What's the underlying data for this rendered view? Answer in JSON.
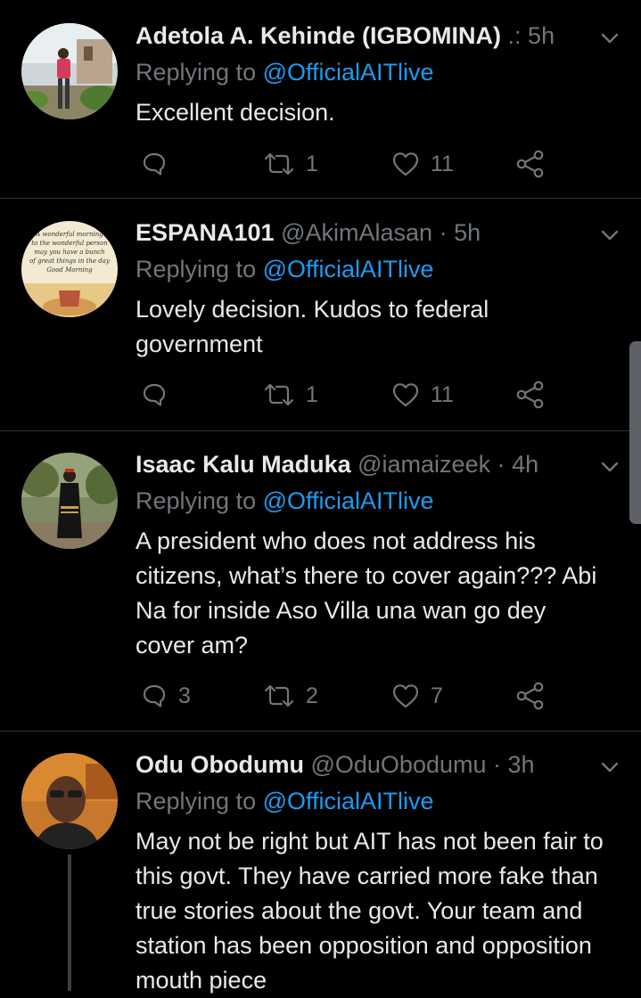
{
  "tweets": [
    {
      "name": "Adetola A. Kehinde (IGBOMINA)",
      "handle": "",
      "separator": ".:",
      "time": "5h",
      "replying_prefix": "Replying to",
      "replying_mention": "@OfficialAITlive",
      "text": "Excellent decision.",
      "replies": "",
      "retweets": "1",
      "likes": "11"
    },
    {
      "name": "ESPANA101",
      "handle": "@AkimAlasan",
      "separator": "·",
      "time": "5h",
      "replying_prefix": "Replying to",
      "replying_mention": "@OfficialAITlive",
      "text": "Lovely decision. Kudos to federal government",
      "replies": "",
      "retweets": "1",
      "likes": "11",
      "avatar_text": [
        "A wonderful morning",
        "to the wonderful person",
        "may you have a bunch",
        "of great things in the day",
        "Good Morning"
      ]
    },
    {
      "name": "Isaac Kalu Maduka",
      "handle": "@iamaizeek",
      "separator": "·",
      "time": "4h",
      "replying_prefix": "Replying to",
      "replying_mention": "@OfficialAITlive",
      "text": "A president who does not address his citizens, what’s there to cover again??? Abi Na for inside Aso Villa una wan go dey cover am?",
      "replies": "3",
      "retweets": "2",
      "likes": "7"
    },
    {
      "name": "Odu Obodumu",
      "handle": "@OduObodumu",
      "separator": "·",
      "time": "3h",
      "replying_prefix": "Replying to",
      "replying_mention": "@OfficialAITlive",
      "text": "May not be right but AIT has not been fair to this govt. They have carried more fake than true stories about the govt. Your team and station has been opposition and opposition mouth piece",
      "replies": "",
      "retweets": "",
      "likes": ""
    }
  ],
  "icons": {
    "reply": "reply-icon",
    "retweet": "retweet-icon",
    "like": "heart-icon",
    "share": "share-icon",
    "more": "chevron-down-icon"
  },
  "colors": {
    "background": "#000000",
    "text": "#e7e9ea",
    "secondary": "#71767b",
    "link": "#1d9bf0",
    "divider": "#2f3336"
  }
}
